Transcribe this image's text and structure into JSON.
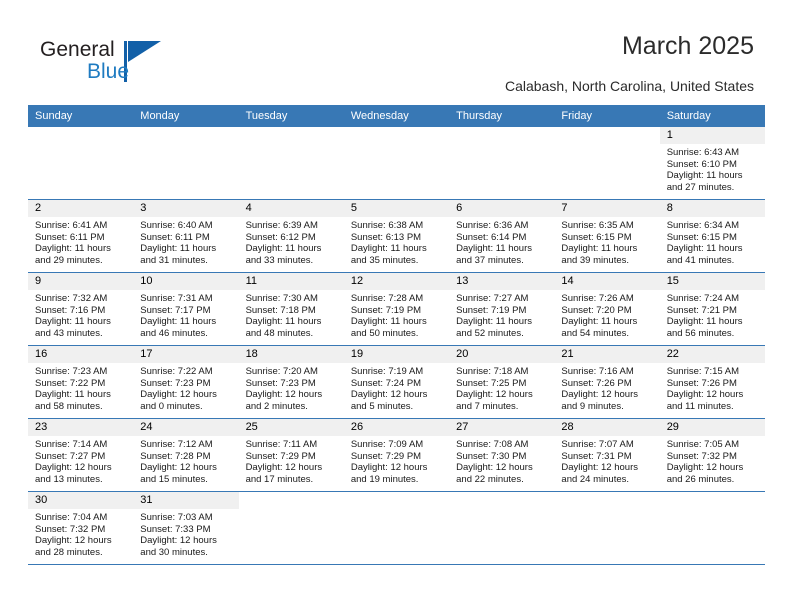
{
  "brand": {
    "name_dark": "General",
    "name_light": "Blue",
    "triangle_color": "#1260a8",
    "accent_color": "#1f7bc1"
  },
  "header": {
    "title": "March 2025",
    "subtitle": "Calabash, North Carolina, United States"
  },
  "theme": {
    "header_row_bg": "#3878b5",
    "daynum_band_bg": "#f0f0f0",
    "row_divider": "#3878b5"
  },
  "columns": [
    "Sunday",
    "Monday",
    "Tuesday",
    "Wednesday",
    "Thursday",
    "Friday",
    "Saturday"
  ],
  "labels": {
    "sunrise_prefix": "Sunrise:",
    "sunset_prefix": "Sunset:",
    "daylight_prefix": "Daylight:"
  },
  "weeks": [
    [
      {
        "blank": true
      },
      {
        "blank": true
      },
      {
        "blank": true
      },
      {
        "blank": true
      },
      {
        "blank": true
      },
      {
        "blank": true
      },
      {
        "day": "1",
        "sunrise": "Sunrise: 6:43 AM",
        "sunset": "Sunset: 6:10 PM",
        "daylight1": "Daylight: 11 hours",
        "daylight2": "and 27 minutes."
      }
    ],
    [
      {
        "day": "2",
        "sunrise": "Sunrise: 6:41 AM",
        "sunset": "Sunset: 6:11 PM",
        "daylight1": "Daylight: 11 hours",
        "daylight2": "and 29 minutes."
      },
      {
        "day": "3",
        "sunrise": "Sunrise: 6:40 AM",
        "sunset": "Sunset: 6:11 PM",
        "daylight1": "Daylight: 11 hours",
        "daylight2": "and 31 minutes."
      },
      {
        "day": "4",
        "sunrise": "Sunrise: 6:39 AM",
        "sunset": "Sunset: 6:12 PM",
        "daylight1": "Daylight: 11 hours",
        "daylight2": "and 33 minutes."
      },
      {
        "day": "5",
        "sunrise": "Sunrise: 6:38 AM",
        "sunset": "Sunset: 6:13 PM",
        "daylight1": "Daylight: 11 hours",
        "daylight2": "and 35 minutes."
      },
      {
        "day": "6",
        "sunrise": "Sunrise: 6:36 AM",
        "sunset": "Sunset: 6:14 PM",
        "daylight1": "Daylight: 11 hours",
        "daylight2": "and 37 minutes."
      },
      {
        "day": "7",
        "sunrise": "Sunrise: 6:35 AM",
        "sunset": "Sunset: 6:15 PM",
        "daylight1": "Daylight: 11 hours",
        "daylight2": "and 39 minutes."
      },
      {
        "day": "8",
        "sunrise": "Sunrise: 6:34 AM",
        "sunset": "Sunset: 6:15 PM",
        "daylight1": "Daylight: 11 hours",
        "daylight2": "and 41 minutes."
      }
    ],
    [
      {
        "day": "9",
        "sunrise": "Sunrise: 7:32 AM",
        "sunset": "Sunset: 7:16 PM",
        "daylight1": "Daylight: 11 hours",
        "daylight2": "and 43 minutes."
      },
      {
        "day": "10",
        "sunrise": "Sunrise: 7:31 AM",
        "sunset": "Sunset: 7:17 PM",
        "daylight1": "Daylight: 11 hours",
        "daylight2": "and 46 minutes."
      },
      {
        "day": "11",
        "sunrise": "Sunrise: 7:30 AM",
        "sunset": "Sunset: 7:18 PM",
        "daylight1": "Daylight: 11 hours",
        "daylight2": "and 48 minutes."
      },
      {
        "day": "12",
        "sunrise": "Sunrise: 7:28 AM",
        "sunset": "Sunset: 7:19 PM",
        "daylight1": "Daylight: 11 hours",
        "daylight2": "and 50 minutes."
      },
      {
        "day": "13",
        "sunrise": "Sunrise: 7:27 AM",
        "sunset": "Sunset: 7:19 PM",
        "daylight1": "Daylight: 11 hours",
        "daylight2": "and 52 minutes."
      },
      {
        "day": "14",
        "sunrise": "Sunrise: 7:26 AM",
        "sunset": "Sunset: 7:20 PM",
        "daylight1": "Daylight: 11 hours",
        "daylight2": "and 54 minutes."
      },
      {
        "day": "15",
        "sunrise": "Sunrise: 7:24 AM",
        "sunset": "Sunset: 7:21 PM",
        "daylight1": "Daylight: 11 hours",
        "daylight2": "and 56 minutes."
      }
    ],
    [
      {
        "day": "16",
        "sunrise": "Sunrise: 7:23 AM",
        "sunset": "Sunset: 7:22 PM",
        "daylight1": "Daylight: 11 hours",
        "daylight2": "and 58 minutes."
      },
      {
        "day": "17",
        "sunrise": "Sunrise: 7:22 AM",
        "sunset": "Sunset: 7:23 PM",
        "daylight1": "Daylight: 12 hours",
        "daylight2": "and 0 minutes."
      },
      {
        "day": "18",
        "sunrise": "Sunrise: 7:20 AM",
        "sunset": "Sunset: 7:23 PM",
        "daylight1": "Daylight: 12 hours",
        "daylight2": "and 2 minutes."
      },
      {
        "day": "19",
        "sunrise": "Sunrise: 7:19 AM",
        "sunset": "Sunset: 7:24 PM",
        "daylight1": "Daylight: 12 hours",
        "daylight2": "and 5 minutes."
      },
      {
        "day": "20",
        "sunrise": "Sunrise: 7:18 AM",
        "sunset": "Sunset: 7:25 PM",
        "daylight1": "Daylight: 12 hours",
        "daylight2": "and 7 minutes."
      },
      {
        "day": "21",
        "sunrise": "Sunrise: 7:16 AM",
        "sunset": "Sunset: 7:26 PM",
        "daylight1": "Daylight: 12 hours",
        "daylight2": "and 9 minutes."
      },
      {
        "day": "22",
        "sunrise": "Sunrise: 7:15 AM",
        "sunset": "Sunset: 7:26 PM",
        "daylight1": "Daylight: 12 hours",
        "daylight2": "and 11 minutes."
      }
    ],
    [
      {
        "day": "23",
        "sunrise": "Sunrise: 7:14 AM",
        "sunset": "Sunset: 7:27 PM",
        "daylight1": "Daylight: 12 hours",
        "daylight2": "and 13 minutes."
      },
      {
        "day": "24",
        "sunrise": "Sunrise: 7:12 AM",
        "sunset": "Sunset: 7:28 PM",
        "daylight1": "Daylight: 12 hours",
        "daylight2": "and 15 minutes."
      },
      {
        "day": "25",
        "sunrise": "Sunrise: 7:11 AM",
        "sunset": "Sunset: 7:29 PM",
        "daylight1": "Daylight: 12 hours",
        "daylight2": "and 17 minutes."
      },
      {
        "day": "26",
        "sunrise": "Sunrise: 7:09 AM",
        "sunset": "Sunset: 7:29 PM",
        "daylight1": "Daylight: 12 hours",
        "daylight2": "and 19 minutes."
      },
      {
        "day": "27",
        "sunrise": "Sunrise: 7:08 AM",
        "sunset": "Sunset: 7:30 PM",
        "daylight1": "Daylight: 12 hours",
        "daylight2": "and 22 minutes."
      },
      {
        "day": "28",
        "sunrise": "Sunrise: 7:07 AM",
        "sunset": "Sunset: 7:31 PM",
        "daylight1": "Daylight: 12 hours",
        "daylight2": "and 24 minutes."
      },
      {
        "day": "29",
        "sunrise": "Sunrise: 7:05 AM",
        "sunset": "Sunset: 7:32 PM",
        "daylight1": "Daylight: 12 hours",
        "daylight2": "and 26 minutes."
      }
    ],
    [
      {
        "day": "30",
        "sunrise": "Sunrise: 7:04 AM",
        "sunset": "Sunset: 7:32 PM",
        "daylight1": "Daylight: 12 hours",
        "daylight2": "and 28 minutes."
      },
      {
        "day": "31",
        "sunrise": "Sunrise: 7:03 AM",
        "sunset": "Sunset: 7:33 PM",
        "daylight1": "Daylight: 12 hours",
        "daylight2": "and 30 minutes."
      },
      {
        "blank": true
      },
      {
        "blank": true
      },
      {
        "blank": true
      },
      {
        "blank": true
      },
      {
        "blank": true
      }
    ]
  ]
}
